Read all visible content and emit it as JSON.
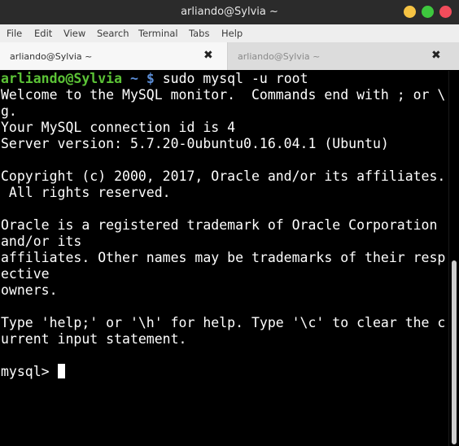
{
  "window": {
    "title": "arliando@Sylvia ~"
  },
  "menu": {
    "items": [
      "File",
      "Edit",
      "View",
      "Search",
      "Terminal",
      "Tabs",
      "Help"
    ]
  },
  "tabs": [
    {
      "label": "arliando@Sylvia ~",
      "close_icon": "close-icon"
    },
    {
      "label": "arliando@Sylvia ~",
      "close_icon": "close-icon"
    }
  ],
  "terminal": {
    "prompt_user": "arliando@Sylvia",
    "prompt_path": " ~ $",
    "command": " sudo mysql -u root",
    "output": [
      "Welcome to the MySQL monitor.  Commands end with ; or \\",
      "g.",
      "Your MySQL connection id is 4",
      "Server version: 5.7.20-0ubuntu0.16.04.1 (Ubuntu)",
      "",
      "Copyright (c) 2000, 2017, Oracle and/or its affiliates.",
      " All rights reserved.",
      "",
      "Oracle is a registered trademark of Oracle Corporation",
      "and/or its",
      "affiliates. Other names may be trademarks of their resp",
      "ective",
      "owners.",
      "",
      "Type 'help;' or '\\h' for help. Type '\\c' to clear the c",
      "urrent input statement.",
      ""
    ],
    "mysql_prompt": "mysql> "
  },
  "colors": {
    "prompt_user": "#5bc236",
    "prompt_path": "#5b8dd6",
    "terminal_bg": "#000000",
    "terminal_fg": "#ffffff"
  }
}
